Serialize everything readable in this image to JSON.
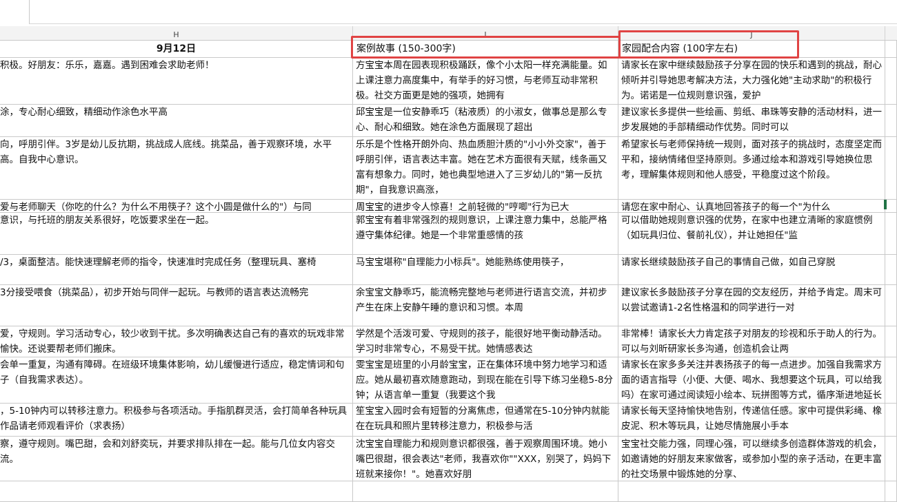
{
  "columns": {
    "h": "H",
    "i": "I",
    "j": "J"
  },
  "header": {
    "date": "9月12日",
    "story": "案例故事 (150-300字)",
    "home": "家园配合内容 (100字左右)"
  },
  "rows": [
    {
      "h": "积极。好朋友：乐乐，嘉嘉。遇到困难会求助老师！",
      "i": "方宝宝本周在园表现积极踊跃，像个小太阳一样充满能量。如上课注意力高度集中，有举手的好习惯，与老师互动非常积极。社交方面更是她的强项，她拥有",
      "j": "请家长在家中继续鼓励孩子分享在园的快乐和遇到的挑战，耐心倾听并引导她思考解决方法，大力强化她\"主动求助\"的积极行为。诺诺是一位规则意识强，爱护"
    },
    {
      "h": "涂，专心耐心细致，精细动作涂色水平高",
      "i": "邱宝宝是一位安静乖巧（粘液质）的小淑女，做事总是那么专心、耐心和细致。她在涂色方面展现了超出",
      "j": "建议家长多提供一些绘画、剪纸、串珠等安静的活动材料，进一步发展她的手部精细动作优势。同时可以"
    },
    {
      "h": "向，呼朋引伴。3岁是幼儿反抗期，挑战成人底线。挑菜品，善于观察环境，水平高。自我中心意识。",
      "i": "乐乐是个性格开朗外向、热血质胆汁质的\"小小外交家\"，善于呼朋引伴，语言表达丰富。她在艺术方面很有天赋，线条画又富有想象力。同时，她也典型地进入了三岁幼儿的\"第一反抗期\"，自我意识高涨，",
      "j": "希望家长与老师保持统一规则，面对孩子的挑战时，态度坚定而平和，接纳情绪但坚持原则。多通过绘本和游戏引导她换位思考，理解集体规则和他人感受，平稳度过这个阶段。"
    },
    {
      "h": "爱与老师聊天（你吃的什么？为什么不用筷子？这个小圆是做什么的\"）与同",
      "i": "周宝宝的进步令人惊喜！之前轻微的\"哼唧\"行为已大",
      "j": "请您在家中耐心、认真地回答孩子的每一个\"为什么"
    },
    {
      "h": "意识，与托班的朋友关系很好，吃饭要求坐在一起。",
      "i": "郭宝宝有着非常强烈的规则意识，上课注意力集中，总能严格遵守集体纪律。她是一个非常重感情的孩",
      "j": "可以借助她规则意识强的优势，在家中也建立清晰的家庭惯例（如玩具归位、餐前礼仪），并让她担任\"监"
    },
    {
      "h": "/3，桌面整洁。能快速理解老师的指令，快速准时完成任务（整理玩具、塞椅",
      "i": "马宝宝堪称\"自理能力小标兵\"。她能熟练使用筷子，",
      "j": "请家长继续鼓励孩子自己的事情自己做，如自己穿脱"
    },
    {
      "h": "3分接受喂食（挑菜品），初步开始与同伴一起玩。与教师的语言表达流畅完",
      "i": "余宝宝文静乖巧，能流畅完整地与老师进行语言交流，并初步产生在床上安静午睡的意识和习惯。本周",
      "j": "建议家长多鼓励孩子分享在园的交友经历，并给予肯定。周末可以尝试邀请1-2名性格温和的同学进行一对"
    },
    {
      "h": "爱，守规则。学习活动专心，较少收到干扰。多次明确表达自己有的喜欢的玩戏非常愉快。还说要帮老师们搬床。",
      "i": "学然是个活泼可爱、守规则的孩子，能很好地平衡动静活动。学习时非常专心，不易受干扰。她情感表达",
      "j": "非常棒！请家长大力肯定孩子对朋友的珍视和乐于助人的行为。可以与刘昕研家长多沟通，创造机会让两"
    },
    {
      "h": "会单一重复，沟通有障碍。在班级环境集体影响，幼儿缓慢进行适应，稳定情词和句子（自我需求表达）。",
      "i": "雯宝宝是班里的小月龄宝宝，正在集体环境中努力地学习和适应。她从最初喜欢随意跑动，到现在能在引导下练习坐稳5-8分钟；从语言单一重复（我要这个我",
      "j": "请家长在家多多关注并表扬孩子的每一点进步。加强自我需求方面的语言指导（小便、大便、喝水、我想要这个玩具，可以给我吗）在家可通过阅读短小绘本、玩拼图等方式，循序渐进地延长她安静专注的时"
    },
    {
      "h": "，5-10钟内可以转移注意力。积极参与各项活动。手指肌群灵活，会打简单各种玩具作品请老师观看评价（求表扬）",
      "i": "笙宝宝入园时会有短暂的分离焦虑，但通常在5-10分钟内就能在在玩具和照片里转移注意力，积极参与活",
      "j": "请家长每天坚持愉快地告别，传递信任感。家中可提供彩绳、橡皮泥、积木等玩具，让她尽情施展小手本"
    },
    {
      "h": "察，遵守规则。嘴巴甜，会和刘舒奕玩，并要求排队排在一起。能与几位女内容交流。",
      "i": "沈宝宝自理能力和规则意识都很强，善于观察周围环境。她小嘴巴很甜，很会表达\"老师，我喜欢你\"\"XXX，别哭了，妈妈下班就来接你！\"。她喜欢好朋",
      "j": "宝宝社交能力强，同理心强，可以继续多创造群体游戏的机会，如邀请她的好朋友来家做客，或参加小型的亲子活动，在更丰富的社交场景中锻炼她的分享、"
    },
    {
      "h": "",
      "i": "",
      "j": ""
    }
  ]
}
